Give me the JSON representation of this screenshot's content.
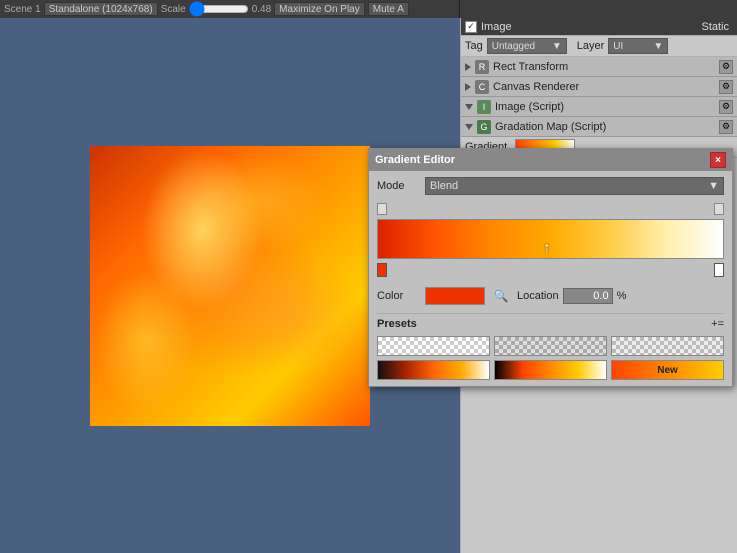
{
  "topbar": {
    "scene_label": "Scene 1",
    "standalone_label": "Standalone (1024x768)",
    "scale_label": "Scale",
    "scale_value": "0.48",
    "maximize_label": "Maximize On Play",
    "mute_label": "Mute A"
  },
  "inspector": {
    "image_label": "Image",
    "static_label": "Static",
    "tag_label": "Tag",
    "tag_value": "Untagged",
    "layer_label": "Layer",
    "layer_value": "UI",
    "components": [
      {
        "name": "Rect Transform",
        "icon": "rect"
      },
      {
        "name": "Canvas Renderer",
        "icon": "canvas"
      },
      {
        "name": "Image (Script)",
        "icon": "image"
      },
      {
        "name": "Gradation Map (Script)",
        "icon": "g"
      }
    ],
    "gradient_label": "Gradient"
  },
  "gradient_editor": {
    "title": "Gradient Editor",
    "mode_label": "Mode",
    "mode_value": "Blend",
    "color_label": "Color",
    "location_label": "Location",
    "location_value": "0.0",
    "percent_label": "%",
    "presets_label": "Presets",
    "presets_add": "+=",
    "new_label": "New",
    "close_label": "×"
  }
}
